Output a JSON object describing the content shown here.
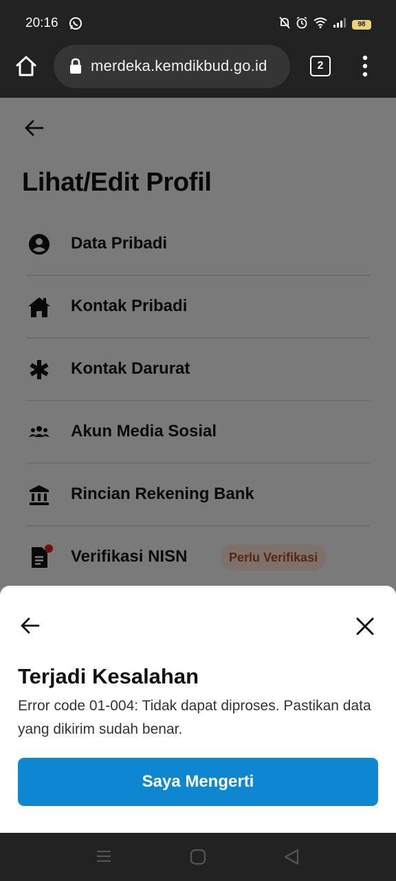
{
  "status_bar": {
    "time": "20:16",
    "battery": "98",
    "icons": [
      "whatsapp-icon",
      "mute-bell-icon",
      "alarm-icon",
      "wifi-icon",
      "signal-icon",
      "battery-icon"
    ]
  },
  "browser": {
    "url": "merdeka.kemdikbud.go.id",
    "tab_count": "2",
    "icons": [
      "home-icon",
      "lock-icon",
      "tabs-icon",
      "more-vert-icon"
    ]
  },
  "page": {
    "title": "Lihat/Edit Profil",
    "menu": [
      {
        "label": "Data Pribadi",
        "icon": "account-circle-icon"
      },
      {
        "label": "Kontak Pribadi",
        "icon": "home-icon"
      },
      {
        "label": "Kontak Darurat",
        "icon": "asterisk-icon"
      },
      {
        "label": "Akun Media Sosial",
        "icon": "people-icon"
      },
      {
        "label": "Rincian Rekening Bank",
        "icon": "bank-icon"
      },
      {
        "label": "Verifikasi NISN",
        "icon": "document-icon",
        "badge": "Perlu Verifikasi"
      }
    ]
  },
  "sheet": {
    "title": "Terjadi Kesalahan",
    "message": "Error code 01-004: Tidak dapat diproses. Pastikan data yang dikirim sudah benar.",
    "button_label": "Saya Mengerti"
  },
  "colors": {
    "primary_button": "#0f87d0",
    "badge_bg": "#fbe3d6",
    "badge_text": "#b0502a",
    "notification_dot": "#e01e1e"
  }
}
